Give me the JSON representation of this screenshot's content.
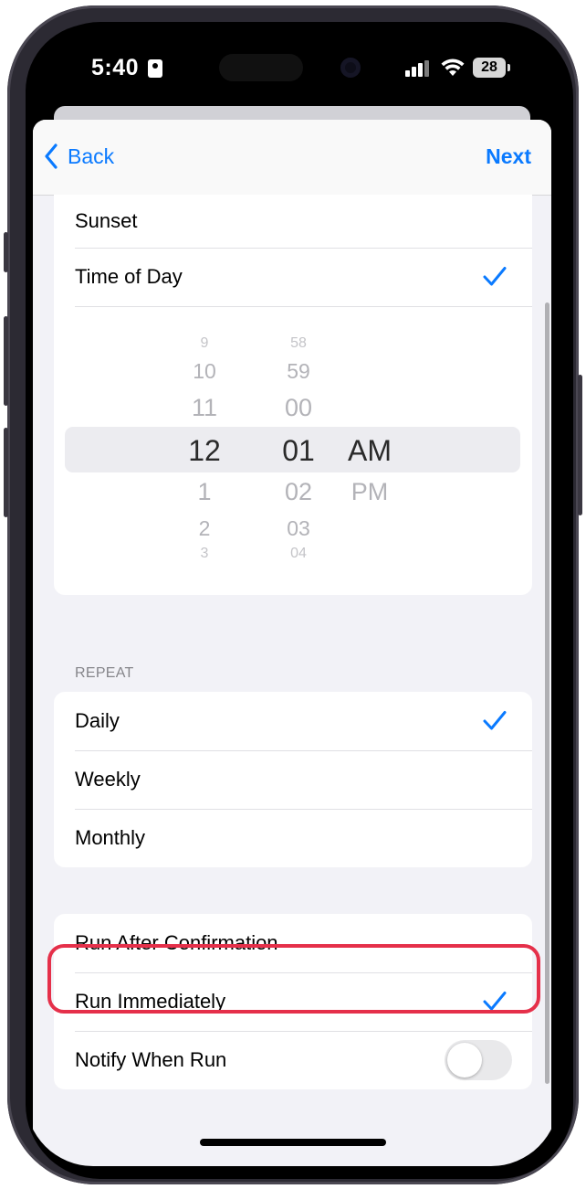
{
  "status_bar": {
    "time": "5:40",
    "battery": "28"
  },
  "nav": {
    "back_label": "Back",
    "next_label": "Next"
  },
  "trigger_options": [
    {
      "label": "Sunset",
      "checked": false
    },
    {
      "label": "Time of Day",
      "checked": true
    }
  ],
  "time_picker": {
    "hours_above": [
      "9",
      "10",
      "11"
    ],
    "hour_selected": "12",
    "hours_below": [
      "1",
      "2",
      "3"
    ],
    "minutes_above": [
      "58",
      "59",
      "00"
    ],
    "minute_selected": "01",
    "minutes_below": [
      "02",
      "03",
      "04"
    ],
    "period_selected": "AM",
    "period_below": "PM"
  },
  "repeat": {
    "section_label": "REPEAT",
    "options": [
      {
        "label": "Daily",
        "checked": true
      },
      {
        "label": "Weekly",
        "checked": false
      },
      {
        "label": "Monthly",
        "checked": false
      }
    ]
  },
  "run_options": {
    "run_after_confirmation": "Run After Confirmation",
    "run_immediately": "Run Immediately",
    "run_immediately_checked": true,
    "notify_when_run": "Notify When Run",
    "notify_toggle_on": false
  },
  "colors": {
    "accent": "#0a7aff",
    "highlight": "#e5304a"
  }
}
